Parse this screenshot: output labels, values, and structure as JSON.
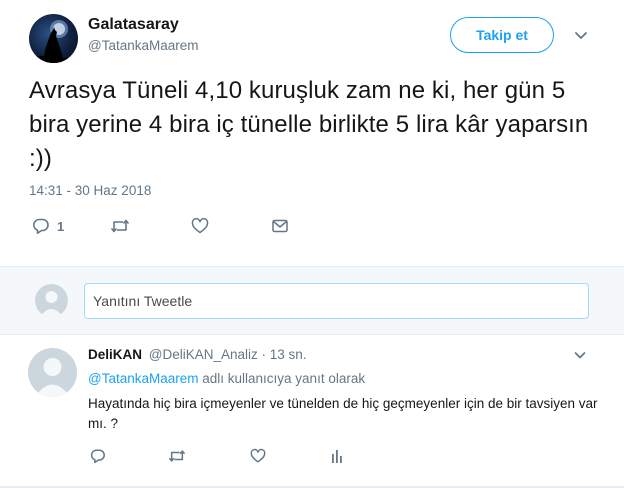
{
  "colors": {
    "accent": "#1da1f2",
    "secondary_text": "#657786",
    "primary_text": "#14171a",
    "reply_bg": "#f5f8fa"
  },
  "tweet": {
    "display_name": "Galatasaray",
    "screen_name": "@TatankaMaarem",
    "follow_label": "Takip et",
    "text": "Avrasya Tüneli 4,10 kuruşluk zam ne ki, her gün 5 bira yerine 4 bira iç tünelle birlikte 5 lira kâr yaparsın :))",
    "timestamp": "14:31 - 30 Haz 2018",
    "actions": {
      "reply_count": "1"
    }
  },
  "reply_box": {
    "placeholder": "Yanıtını Tweetle"
  },
  "reply": {
    "display_name": "DeliKAN",
    "screen_name": "@DeliKAN_Analiz",
    "time": " · 13 sn.",
    "mention": "@TatankaMaarem",
    "reply_to_suffix": " adlı kullanıcıya yanıt olarak",
    "text": "Hayatında hiç bira içmeyenler ve tünelden de hiç geçmeyenler için de bir tavsiyen var mı. ?"
  },
  "icons": {
    "main_avatar": "howling-wolf-avatar-icon",
    "more": "chevron-down-icon",
    "reply": "reply-bubble-icon",
    "retweet": "retweet-icon",
    "like": "heart-icon",
    "message": "direct-message-icon",
    "analytics": "analytics-bars-icon",
    "default_avatar": "default-user-avatar-icon"
  }
}
